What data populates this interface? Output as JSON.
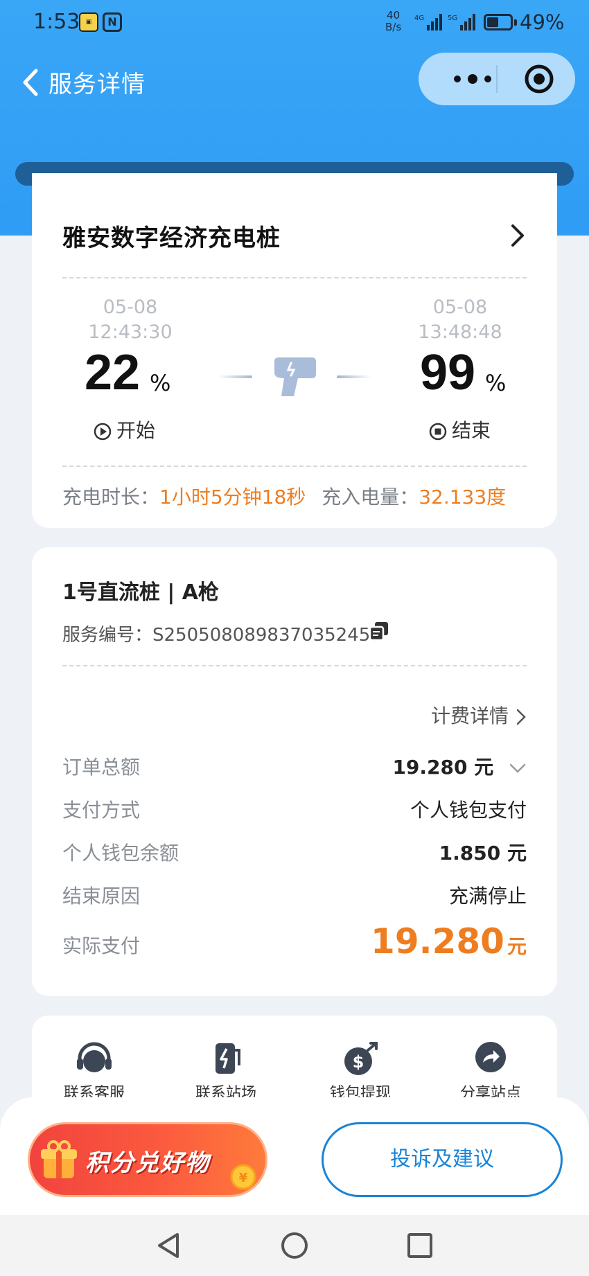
{
  "status_bar": {
    "time": "1:53",
    "speed_value": "40",
    "speed_unit": "B/s",
    "net1": "4G",
    "net2": "5G",
    "battery_percent": "49%",
    "battery_level": 0.49
  },
  "nav": {
    "title": "服务详情"
  },
  "session": {
    "station_name": "雅安数字经济充电桩",
    "start_date": "05-08",
    "start_time": "12:43:30",
    "start_percent": "22",
    "end_date": "05-08",
    "end_time": "13:48:48",
    "end_percent": "99",
    "percent_sign": "%",
    "start_label": "开始",
    "end_label": "结束",
    "duration_label": "充电时长：",
    "duration_value": "1小时5分钟18秒",
    "energy_label": "充入电量：",
    "energy_value": "32.133度"
  },
  "order": {
    "pile_title": "1号直流桩 | A枪",
    "service_no_label": "服务编号：",
    "service_no": "S2505080898370352455",
    "billing_link": "计费详情",
    "rows": [
      {
        "label": "订单总额",
        "value": "19.280 元"
      },
      {
        "label": "支付方式",
        "value": "个人钱包支付"
      },
      {
        "label": "个人钱包余额",
        "value": "1.850 元"
      },
      {
        "label": "结束原因",
        "value": "充满停止"
      }
    ],
    "actual_label": "实际支付",
    "actual_amount": "19.280",
    "actual_unit": "元"
  },
  "actions": [
    {
      "label": "联系客服",
      "icon": "headset-icon"
    },
    {
      "label": "联系站场",
      "icon": "charging-station-icon"
    },
    {
      "label": "钱包提现",
      "icon": "money-bag-icon"
    },
    {
      "label": "分享站点",
      "icon": "share-icon"
    }
  ],
  "bottom": {
    "promo_label": "积分兑好物",
    "complain_label": "投诉及建议"
  },
  "colors": {
    "accent_orange": "#ee7d20",
    "accent_blue": "#1a84d6",
    "header_blue": "#3aa6f6"
  }
}
